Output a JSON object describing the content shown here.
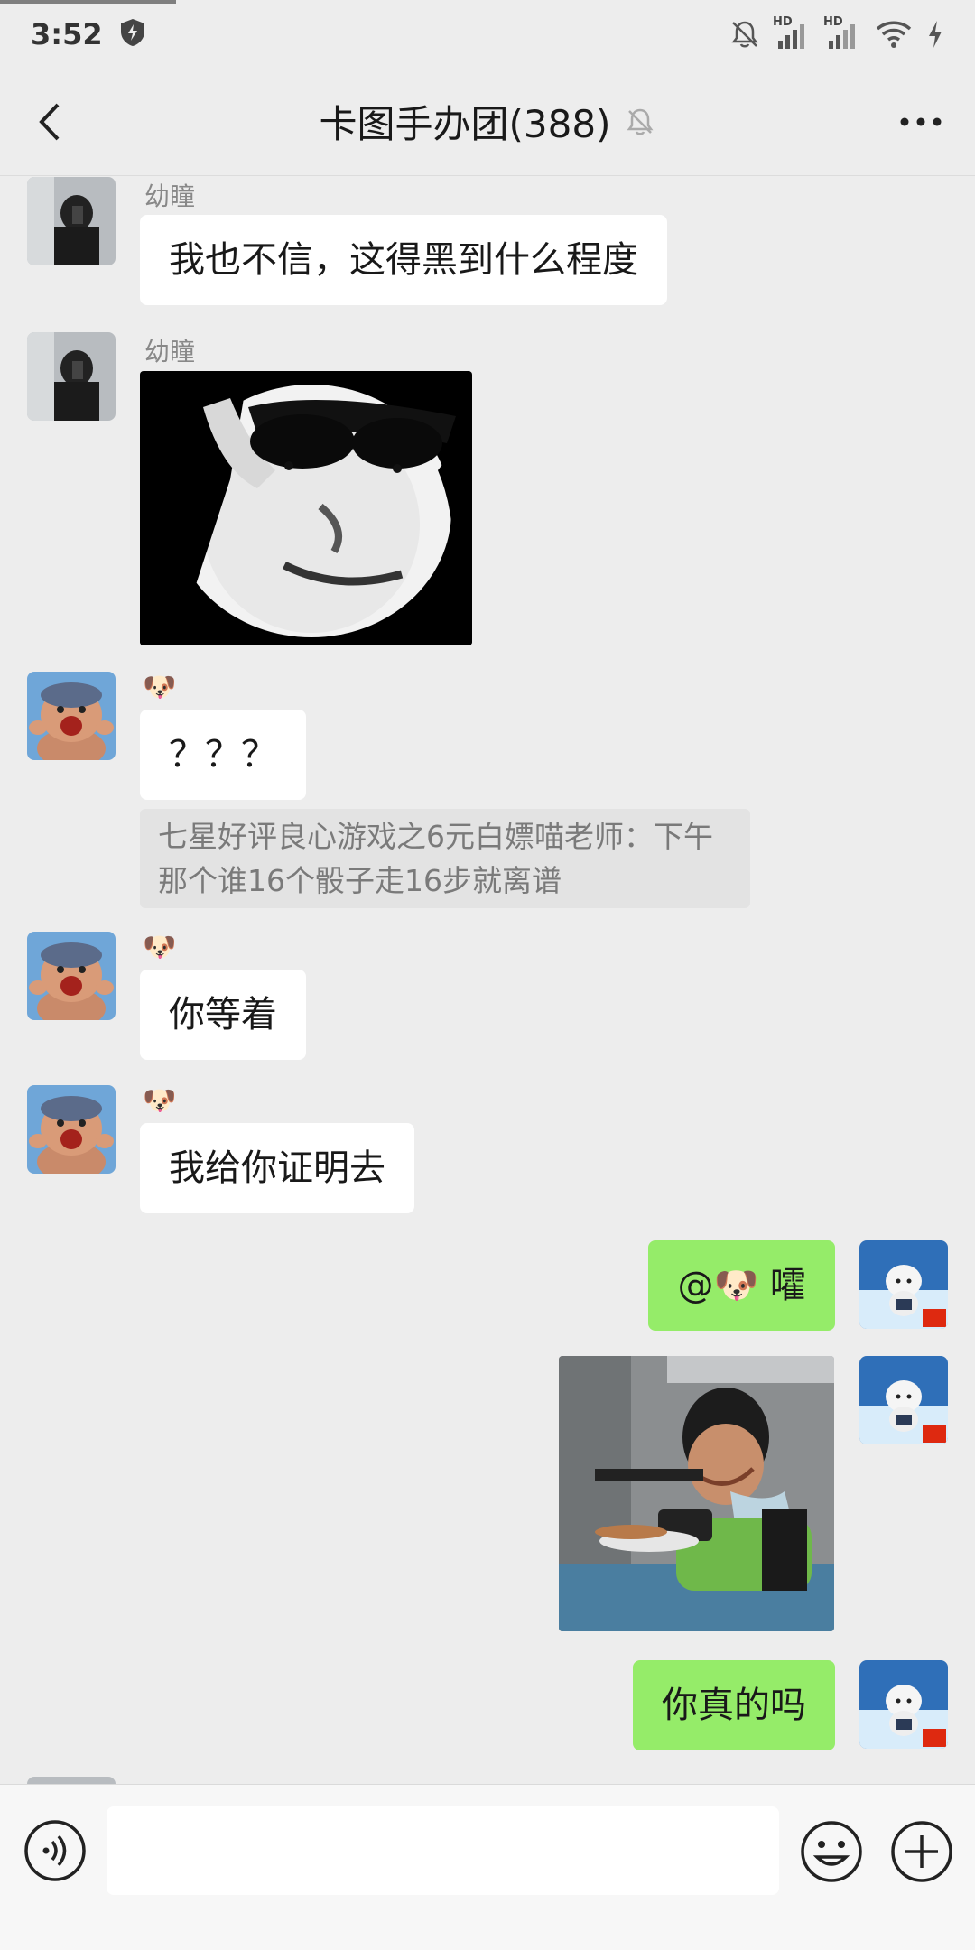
{
  "status_bar": {
    "time": "3:52",
    "sim1": "HD",
    "sim2": "HD"
  },
  "header": {
    "title": "卡图手办团(388)",
    "back_icon": "chevron-left-icon",
    "mute_icon": "bell-off-icon",
    "more_icon": "more-dots-icon"
  },
  "messages": [
    {
      "type": "text",
      "side": "left",
      "sender": "幼瞳",
      "text": "我也不信，这得黑到什么程度"
    },
    {
      "type": "image",
      "side": "left",
      "sender": "幼瞳",
      "image": "sunglasses-meme-sticker"
    },
    {
      "type": "text",
      "side": "left",
      "sender": "🐶",
      "text": "？？？",
      "quote": "七星好评良心游戏之6元白嫖喵老师：下午那个谁16个骰子走16步就离谱"
    },
    {
      "type": "text",
      "side": "left",
      "sender": "🐶",
      "text": "你等着"
    },
    {
      "type": "text",
      "side": "left",
      "sender": "🐶",
      "text": "我给你证明去"
    },
    {
      "type": "text",
      "side": "right",
      "text": "@🐶  嚯"
    },
    {
      "type": "image",
      "side": "right",
      "image": "boy-laughing-at-phone-photo"
    },
    {
      "type": "text",
      "side": "right",
      "text": "你真的吗"
    }
  ],
  "input_bar": {
    "placeholder": "",
    "voice_icon": "voice-icon",
    "emoji_icon": "emoji-icon",
    "plus_icon": "plus-icon"
  },
  "colors": {
    "background": "#ededed",
    "bubble_self": "#95ec69",
    "bubble_other": "#ffffff"
  }
}
